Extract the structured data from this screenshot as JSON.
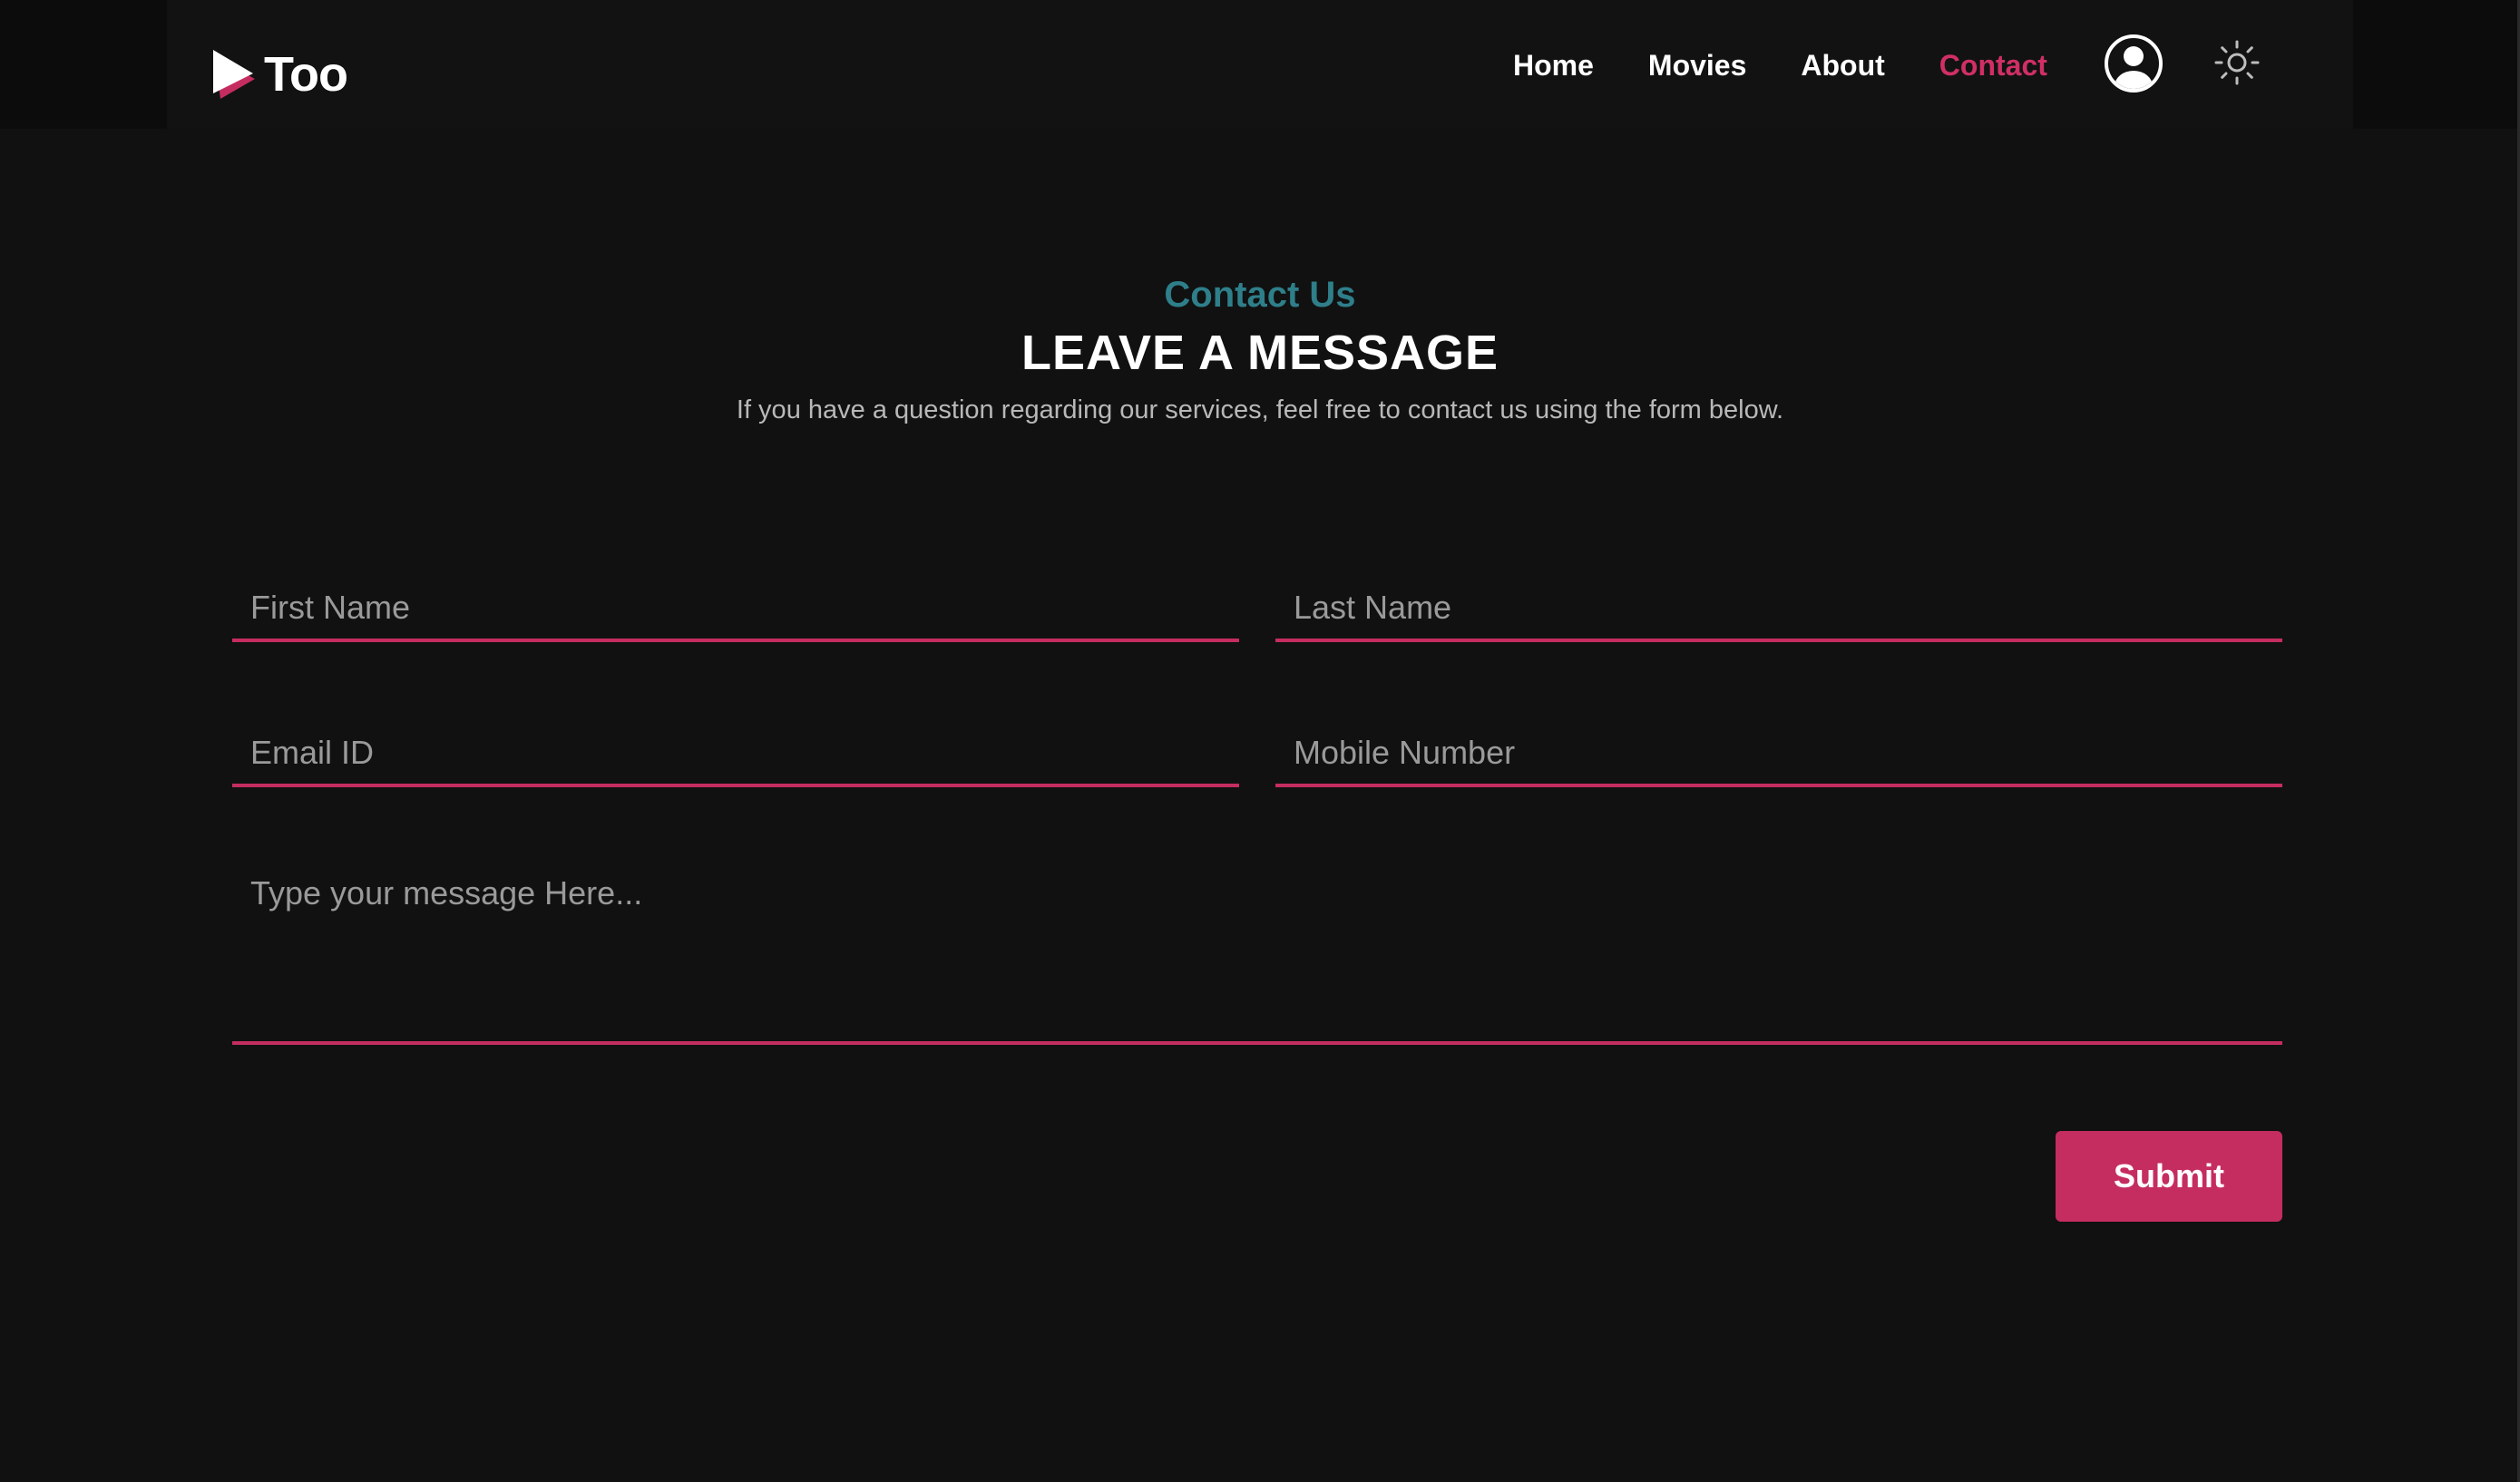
{
  "brand": {
    "name": "Too"
  },
  "nav": {
    "items": [
      {
        "label": "Home",
        "active": false
      },
      {
        "label": "Movies",
        "active": false
      },
      {
        "label": "About",
        "active": false
      },
      {
        "label": "Contact",
        "active": true
      }
    ],
    "user_icon": "user-circle-icon",
    "theme_icon": "sun-icon"
  },
  "heading": {
    "eyebrow": "Contact Us",
    "title": "LEAVE A MESSAGE",
    "subtitle": "If you have a question regarding our services, feel free to contact us using the form below."
  },
  "form": {
    "first_name": {
      "value": "",
      "placeholder": "First Name"
    },
    "last_name": {
      "value": "",
      "placeholder": "Last Name"
    },
    "email": {
      "value": "",
      "placeholder": "Email ID"
    },
    "mobile": {
      "value": "",
      "placeholder": "Mobile Number"
    },
    "message": {
      "value": "",
      "placeholder": "Type your message Here..."
    },
    "submit_label": "Submit"
  },
  "colors": {
    "accent": "#c52d60",
    "eyebrow": "#2e7f8a",
    "background": "#111111"
  }
}
